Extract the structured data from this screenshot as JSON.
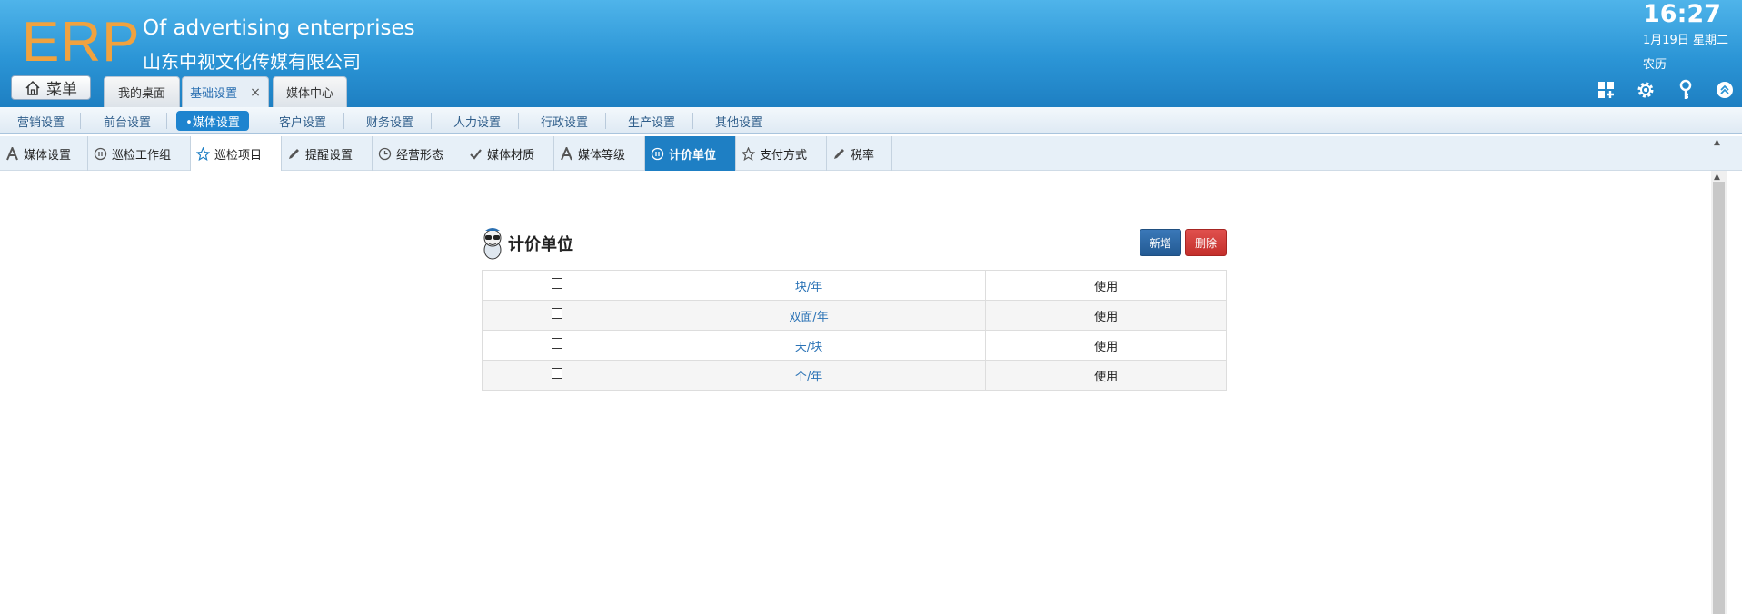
{
  "header": {
    "logo": "ERP",
    "company_en": "Of advertising enterprises",
    "company_cn": "山东中视文化传媒有限公司",
    "menu_label": "菜单",
    "time": "16:27",
    "date": "1月19日 星期二",
    "lunar": "农历",
    "icons": [
      "grid-add-icon",
      "gear-icon",
      "key-icon",
      "collapse-up-icon"
    ]
  },
  "top_tabs": [
    {
      "label": "我的桌面",
      "active": false
    },
    {
      "label": "基础设置",
      "active": true,
      "closable": true
    },
    {
      "label": "媒体中心",
      "active": false
    }
  ],
  "module_nav": [
    {
      "label": "营销设置"
    },
    {
      "label": "前台设置"
    },
    {
      "label": "•媒体设置",
      "active": true
    },
    {
      "label": "客户设置"
    },
    {
      "label": "财务设置"
    },
    {
      "label": "人力设置"
    },
    {
      "label": "行政设置"
    },
    {
      "label": "生产设置"
    },
    {
      "label": "其他设置"
    }
  ],
  "sub_tabs": [
    {
      "label": "媒体设置",
      "icon": "letter-a-icon"
    },
    {
      "label": "巡检工作组",
      "icon": "pause-circle-icon"
    },
    {
      "label": "巡检项目",
      "icon": "star-icon",
      "selected": true
    },
    {
      "label": "提醒设置",
      "icon": "pencil-icon"
    },
    {
      "label": "经营形态",
      "icon": "clock-icon"
    },
    {
      "label": "媒体材质",
      "icon": "check-icon"
    },
    {
      "label": "媒体等级",
      "icon": "letter-a-icon"
    },
    {
      "label": "计价单位",
      "icon": "pause-circle-icon",
      "active": true
    },
    {
      "label": "支付方式",
      "icon": "star-icon"
    },
    {
      "label": "税率",
      "icon": "pencil-icon"
    }
  ],
  "panel": {
    "title": "计价单位",
    "add_label": "新增",
    "delete_label": "删除",
    "rows": [
      {
        "unit": "块/年",
        "status": "使用"
      },
      {
        "unit": "双面/年",
        "status": "使用"
      },
      {
        "unit": "天/块",
        "status": "使用"
      },
      {
        "unit": "个/年",
        "status": "使用"
      }
    ]
  },
  "colors": {
    "header_blue": "#2b95d6",
    "logo_orange": "#f0a23f",
    "active_tab": "#1e7fc4",
    "add_button": "#235a93",
    "delete_button": "#c42f2b",
    "link_blue": "#2b73b6"
  }
}
